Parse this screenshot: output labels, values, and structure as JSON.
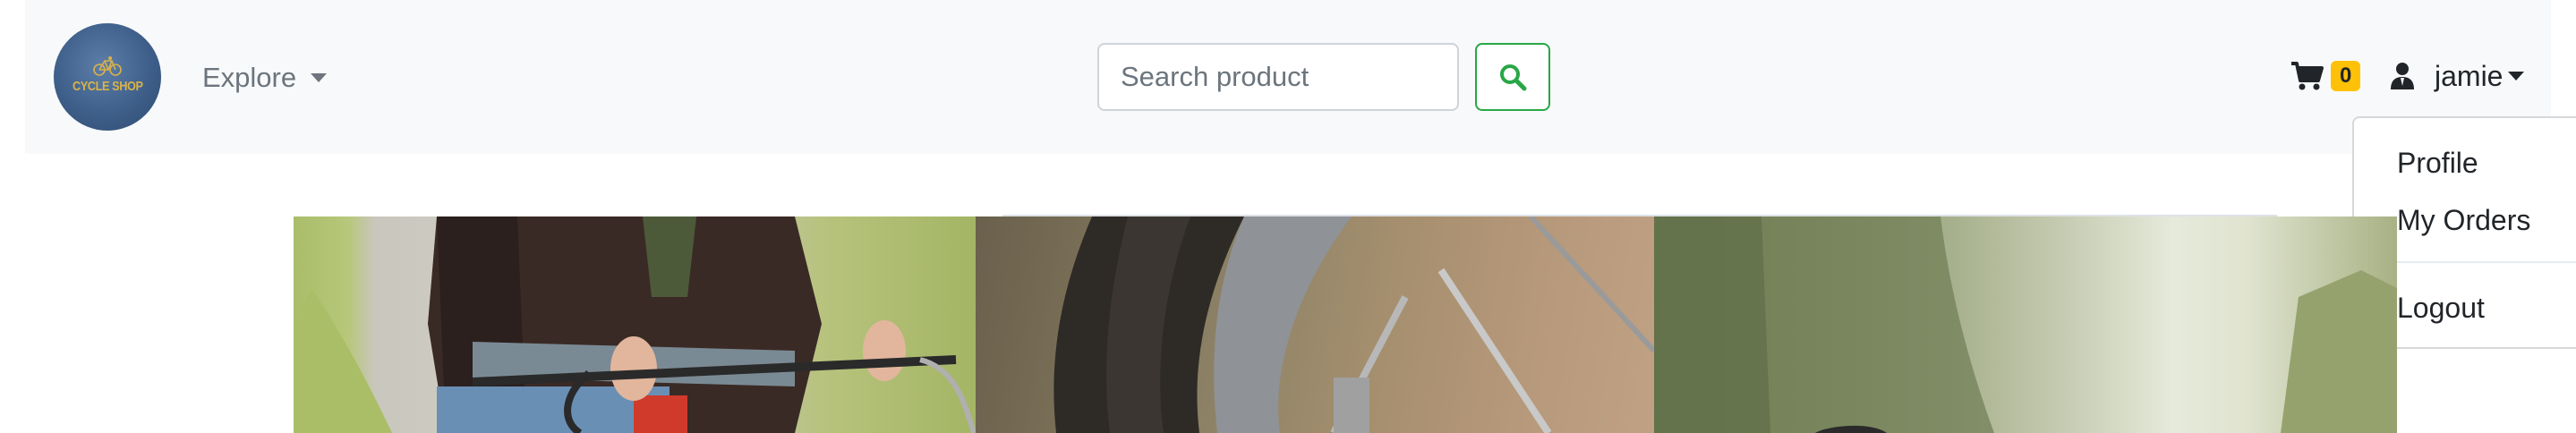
{
  "brand": {
    "logo_text": "CYCLE SHOP",
    "colors": {
      "circle": "#3e5f8a",
      "text": "#d9b24a"
    }
  },
  "nav": {
    "explore_label": "Explore"
  },
  "search": {
    "placeholder": "Search product",
    "button_icon": "magnifier-icon",
    "accent": "#28a745"
  },
  "cart": {
    "icon": "shopping-cart-icon",
    "count": "0",
    "badge_color": "#ffc107"
  },
  "user": {
    "icon": "user-icon",
    "name": "jamie"
  },
  "user_menu": {
    "items": [
      "Profile",
      "My Orders",
      "Logout"
    ]
  },
  "hero": {
    "images": [
      "cyclist-handlebars-photo",
      "bicycle-tire-photo",
      "forest-road-photo"
    ]
  }
}
